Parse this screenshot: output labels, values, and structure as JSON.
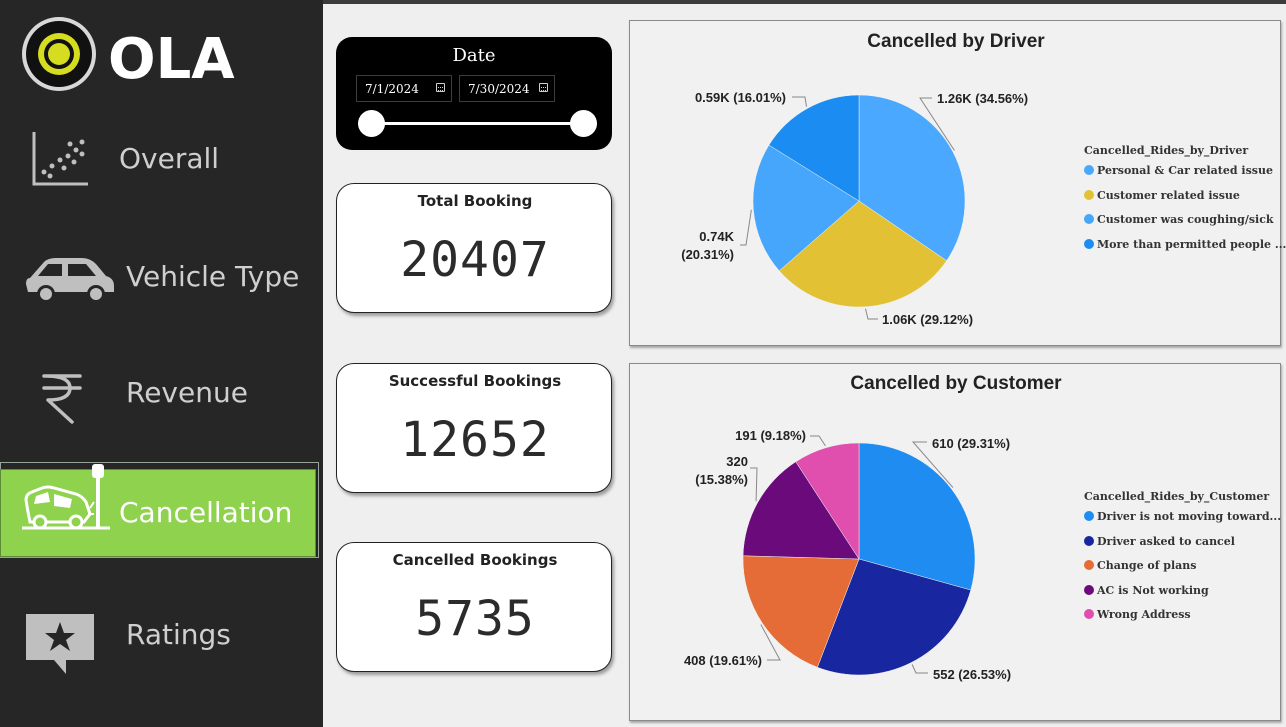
{
  "brand": {
    "name": "OLA"
  },
  "sidebar": {
    "items": [
      {
        "label": "Overall",
        "icon": "scatter-chart-icon"
      },
      {
        "label": "Vehicle Type",
        "icon": "car-icon"
      },
      {
        "label": "Revenue",
        "icon": "rupee-icon"
      },
      {
        "label": "Cancellation",
        "icon": "car-crash-icon",
        "active": true
      },
      {
        "label": "Ratings",
        "icon": "star-message-icon"
      }
    ],
    "active_color": "#8ed24e"
  },
  "date_filter": {
    "title": "Date",
    "start": "7/1/2024",
    "end": "7/30/2024"
  },
  "kpis": {
    "total": {
      "title": "Total Booking",
      "value": "20407"
    },
    "successful": {
      "title": "Successful Bookings",
      "value": "12652"
    },
    "cancelled": {
      "title": "Cancelled Bookings",
      "value": "5735"
    }
  },
  "chart_data": [
    {
      "type": "pie",
      "title": "Cancelled by Driver",
      "legend_title": "Cancelled_Rides_by_Driver",
      "legend_position": "right",
      "slices": [
        {
          "label": "Personal & Car related issue",
          "value": 1.26,
          "display": "1.26K (34.56%)",
          "color": "#4aa8ff"
        },
        {
          "label": "Customer related issue",
          "value": 1.06,
          "display": "1.06K (29.12%)",
          "color": "#e2c135"
        },
        {
          "label": "Customer was coughing/sick",
          "value": 0.74,
          "display_lines": [
            "0.74K",
            "(20.31%)"
          ],
          "color": "#46a6fb"
        },
        {
          "label": "More than permitted people ...",
          "value": 0.59,
          "display": "0.59K (16.01%)",
          "color": "#1a8cf2"
        }
      ]
    },
    {
      "type": "pie",
      "title": "Cancelled by Customer",
      "legend_title": "Cancelled_Rides_by_Customer",
      "legend_position": "right",
      "slices": [
        {
          "label": "Driver is not moving toward...",
          "value": 610,
          "display": "610 (29.31%)",
          "color": "#1e8cf0"
        },
        {
          "label": "Driver asked to cancel",
          "value": 552,
          "display": "552 (26.53%)",
          "color": "#1826a0"
        },
        {
          "label": "Change of plans",
          "value": 408,
          "display": "408 (19.61%)",
          "color": "#e66c37"
        },
        {
          "label": "AC is Not working",
          "value": 320,
          "display_lines": [
            "320",
            "(15.38%)"
          ],
          "color": "#6b0a7a"
        },
        {
          "label": "Wrong Address",
          "value": 191,
          "display": "191 (9.18%)",
          "color": "#e04fae"
        }
      ]
    }
  ]
}
